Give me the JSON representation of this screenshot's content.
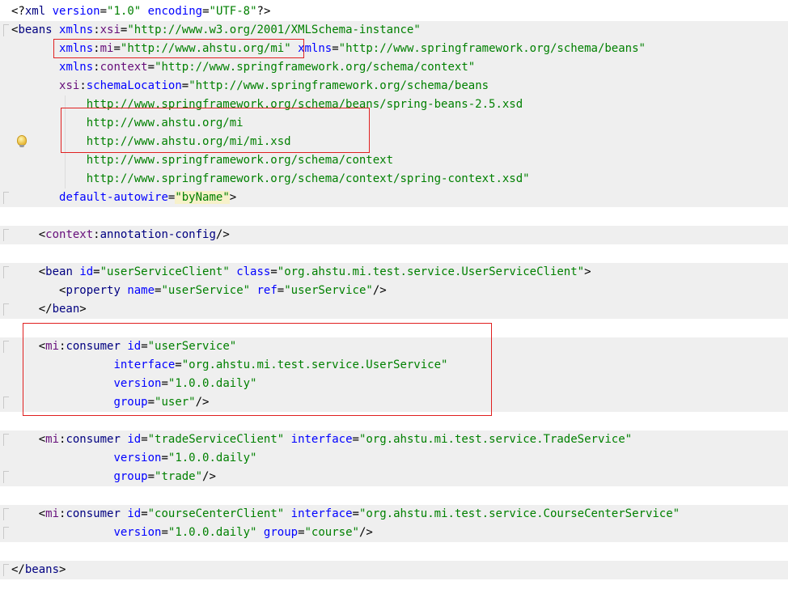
{
  "code_lines": [
    {
      "tokens": [
        {
          "c": "bracket",
          "t": "<?"
        },
        {
          "c": "tag",
          "t": "xml"
        },
        {
          "c": "plain",
          "t": " "
        },
        {
          "c": "attr",
          "t": "version"
        },
        {
          "c": "plain",
          "t": "="
        },
        {
          "c": "val",
          "t": "\"1.0\""
        },
        {
          "c": "plain",
          "t": " "
        },
        {
          "c": "attr",
          "t": "encoding"
        },
        {
          "c": "plain",
          "t": "="
        },
        {
          "c": "val",
          "t": "\"UTF-8\""
        },
        {
          "c": "bracket",
          "t": "?>"
        }
      ]
    },
    {
      "tokens": [
        {
          "c": "bracket",
          "t": "<"
        },
        {
          "c": "tag",
          "t": "beans"
        },
        {
          "c": "plain",
          "t": " "
        },
        {
          "c": "attr",
          "t": "xmlns"
        },
        {
          "c": "plain",
          "t": ":"
        },
        {
          "c": "ns",
          "t": "xsi"
        },
        {
          "c": "plain",
          "t": "="
        },
        {
          "c": "val",
          "t": "\"http://www.w3.org/2001/XMLSchema-instance\""
        }
      ]
    },
    {
      "tokens": [
        {
          "c": "plain",
          "t": "       "
        },
        {
          "c": "attr",
          "t": "xmlns"
        },
        {
          "c": "plain",
          "t": ":"
        },
        {
          "c": "ns",
          "t": "mi"
        },
        {
          "c": "plain",
          "t": "="
        },
        {
          "c": "val",
          "t": "\"http://www.ahstu.org/mi\""
        },
        {
          "c": "plain",
          "t": " "
        },
        {
          "c": "attr",
          "t": "xmlns"
        },
        {
          "c": "plain",
          "t": "="
        },
        {
          "c": "val",
          "t": "\"http://www.springframework.org/schema/beans\""
        }
      ]
    },
    {
      "tokens": [
        {
          "c": "plain",
          "t": "       "
        },
        {
          "c": "attr",
          "t": "xmlns"
        },
        {
          "c": "plain",
          "t": ":"
        },
        {
          "c": "ns",
          "t": "context"
        },
        {
          "c": "plain",
          "t": "="
        },
        {
          "c": "val",
          "t": "\"http://www.springframework.org/schema/context\""
        }
      ]
    },
    {
      "tokens": [
        {
          "c": "plain",
          "t": "       "
        },
        {
          "c": "ns",
          "t": "xsi"
        },
        {
          "c": "plain",
          "t": ":"
        },
        {
          "c": "attr",
          "t": "schemaLocation"
        },
        {
          "c": "plain",
          "t": "="
        },
        {
          "c": "val",
          "t": "\"http://www.springframework.org/schema/beans"
        }
      ]
    },
    {
      "tokens": [
        {
          "c": "plain",
          "t": "           "
        },
        {
          "c": "val",
          "t": "http://www.springframework.org/schema/beans/spring-beans-2.5.xsd"
        }
      ]
    },
    {
      "tokens": [
        {
          "c": "plain",
          "t": "           "
        },
        {
          "c": "val",
          "t": "http://www.ahstu.org/mi"
        }
      ]
    },
    {
      "tokens": [
        {
          "c": "plain",
          "t": "           "
        },
        {
          "c": "val",
          "t": "http://www.ahstu.org/mi/mi.xsd"
        }
      ]
    },
    {
      "tokens": [
        {
          "c": "plain",
          "t": "           "
        },
        {
          "c": "val",
          "t": "http://www.springframework.org/schema/context"
        }
      ]
    },
    {
      "tokens": [
        {
          "c": "plain",
          "t": "           "
        },
        {
          "c": "val",
          "t": "http://www.springframework.org/schema/context/spring-context.xsd\""
        }
      ]
    },
    {
      "tokens": [
        {
          "c": "plain",
          "t": "       "
        },
        {
          "c": "attr",
          "t": "default-autowire"
        },
        {
          "c": "plain",
          "t": "="
        },
        {
          "c": "val",
          "t": "\"byName\""
        },
        {
          "c": "bracket",
          "t": ">"
        }
      ]
    },
    {
      "tokens": []
    },
    {
      "tokens": [
        {
          "c": "plain",
          "t": "    "
        },
        {
          "c": "bracket",
          "t": "<"
        },
        {
          "c": "ns",
          "t": "context"
        },
        {
          "c": "plain",
          "t": ":"
        },
        {
          "c": "tag",
          "t": "annotation-config"
        },
        {
          "c": "bracket",
          "t": "/>"
        }
      ]
    },
    {
      "tokens": []
    },
    {
      "tokens": [
        {
          "c": "plain",
          "t": "    "
        },
        {
          "c": "bracket",
          "t": "<"
        },
        {
          "c": "tag",
          "t": "bean"
        },
        {
          "c": "plain",
          "t": " "
        },
        {
          "c": "attr",
          "t": "id"
        },
        {
          "c": "plain",
          "t": "="
        },
        {
          "c": "val",
          "t": "\"userServiceClient\""
        },
        {
          "c": "plain",
          "t": " "
        },
        {
          "c": "attr",
          "t": "class"
        },
        {
          "c": "plain",
          "t": "="
        },
        {
          "c": "val",
          "t": "\"org.ahstu.mi.test.service.UserServiceClient\""
        },
        {
          "c": "bracket",
          "t": ">"
        }
      ]
    },
    {
      "tokens": [
        {
          "c": "plain",
          "t": "       "
        },
        {
          "c": "bracket",
          "t": "<"
        },
        {
          "c": "tag",
          "t": "property"
        },
        {
          "c": "plain",
          "t": " "
        },
        {
          "c": "attr",
          "t": "name"
        },
        {
          "c": "plain",
          "t": "="
        },
        {
          "c": "val",
          "t": "\"userService\""
        },
        {
          "c": "plain",
          "t": " "
        },
        {
          "c": "attr",
          "t": "ref"
        },
        {
          "c": "plain",
          "t": "="
        },
        {
          "c": "val",
          "t": "\"userService\""
        },
        {
          "c": "bracket",
          "t": "/>"
        }
      ]
    },
    {
      "tokens": [
        {
          "c": "plain",
          "t": "    "
        },
        {
          "c": "bracket",
          "t": "</"
        },
        {
          "c": "tag",
          "t": "bean"
        },
        {
          "c": "bracket",
          "t": ">"
        }
      ]
    },
    {
      "tokens": []
    },
    {
      "tokens": [
        {
          "c": "plain",
          "t": "    "
        },
        {
          "c": "bracket",
          "t": "<"
        },
        {
          "c": "ns",
          "t": "mi"
        },
        {
          "c": "plain",
          "t": ":"
        },
        {
          "c": "tag",
          "t": "consumer"
        },
        {
          "c": "plain",
          "t": " "
        },
        {
          "c": "attr",
          "t": "id"
        },
        {
          "c": "plain",
          "t": "="
        },
        {
          "c": "val",
          "t": "\"userService\""
        }
      ]
    },
    {
      "tokens": [
        {
          "c": "plain",
          "t": "               "
        },
        {
          "c": "attr",
          "t": "interface"
        },
        {
          "c": "plain",
          "t": "="
        },
        {
          "c": "val",
          "t": "\"org.ahstu.mi.test.service.UserService\""
        }
      ]
    },
    {
      "tokens": [
        {
          "c": "plain",
          "t": "               "
        },
        {
          "c": "attr",
          "t": "version"
        },
        {
          "c": "plain",
          "t": "="
        },
        {
          "c": "val",
          "t": "\"1.0.0.daily\""
        }
      ]
    },
    {
      "tokens": [
        {
          "c": "plain",
          "t": "               "
        },
        {
          "c": "attr",
          "t": "group"
        },
        {
          "c": "plain",
          "t": "="
        },
        {
          "c": "val",
          "t": "\"user\""
        },
        {
          "c": "bracket",
          "t": "/>"
        }
      ]
    },
    {
      "tokens": []
    },
    {
      "tokens": [
        {
          "c": "plain",
          "t": "    "
        },
        {
          "c": "bracket",
          "t": "<"
        },
        {
          "c": "ns",
          "t": "mi"
        },
        {
          "c": "plain",
          "t": ":"
        },
        {
          "c": "tag",
          "t": "consumer"
        },
        {
          "c": "plain",
          "t": " "
        },
        {
          "c": "attr",
          "t": "id"
        },
        {
          "c": "plain",
          "t": "="
        },
        {
          "c": "val",
          "t": "\"tradeServiceClient\""
        },
        {
          "c": "plain",
          "t": " "
        },
        {
          "c": "attr",
          "t": "interface"
        },
        {
          "c": "plain",
          "t": "="
        },
        {
          "c": "val",
          "t": "\"org.ahstu.mi.test.service.TradeService\""
        }
      ]
    },
    {
      "tokens": [
        {
          "c": "plain",
          "t": "               "
        },
        {
          "c": "attr",
          "t": "version"
        },
        {
          "c": "plain",
          "t": "="
        },
        {
          "c": "val",
          "t": "\"1.0.0.daily\""
        }
      ]
    },
    {
      "tokens": [
        {
          "c": "plain",
          "t": "               "
        },
        {
          "c": "attr",
          "t": "group"
        },
        {
          "c": "plain",
          "t": "="
        },
        {
          "c": "val",
          "t": "\"trade\""
        },
        {
          "c": "bracket",
          "t": "/>"
        }
      ]
    },
    {
      "tokens": []
    },
    {
      "tokens": [
        {
          "c": "plain",
          "t": "    "
        },
        {
          "c": "bracket",
          "t": "<"
        },
        {
          "c": "ns",
          "t": "mi"
        },
        {
          "c": "plain",
          "t": ":"
        },
        {
          "c": "tag",
          "t": "consumer"
        },
        {
          "c": "plain",
          "t": " "
        },
        {
          "c": "attr",
          "t": "id"
        },
        {
          "c": "plain",
          "t": "="
        },
        {
          "c": "val",
          "t": "\"courseCenterClient\""
        },
        {
          "c": "plain",
          "t": " "
        },
        {
          "c": "attr",
          "t": "interface"
        },
        {
          "c": "plain",
          "t": "="
        },
        {
          "c": "val",
          "t": "\"org.ahstu.mi.test.service.CourseCenterService\""
        }
      ]
    },
    {
      "tokens": [
        {
          "c": "plain",
          "t": "               "
        },
        {
          "c": "attr",
          "t": "version"
        },
        {
          "c": "plain",
          "t": "="
        },
        {
          "c": "val",
          "t": "\"1.0.0.daily\""
        },
        {
          "c": "plain",
          "t": " "
        },
        {
          "c": "attr",
          "t": "group"
        },
        {
          "c": "plain",
          "t": "="
        },
        {
          "c": "val",
          "t": "\"course\""
        },
        {
          "c": "bracket",
          "t": "/>"
        }
      ]
    },
    {
      "tokens": []
    },
    {
      "tokens": [
        {
          "c": "bracket",
          "t": "</"
        },
        {
          "c": "tag",
          "t": "beans"
        },
        {
          "c": "bracket",
          "t": ">"
        }
      ]
    }
  ],
  "colors": {
    "tag": "#000080",
    "attribute": "#0000ff",
    "namespace": "#660e7a",
    "value": "#008000",
    "annotation_box": "#e02020",
    "current_line": "#efefef"
  },
  "icons": {
    "gutter_hint": "lightbulb-icon"
  }
}
